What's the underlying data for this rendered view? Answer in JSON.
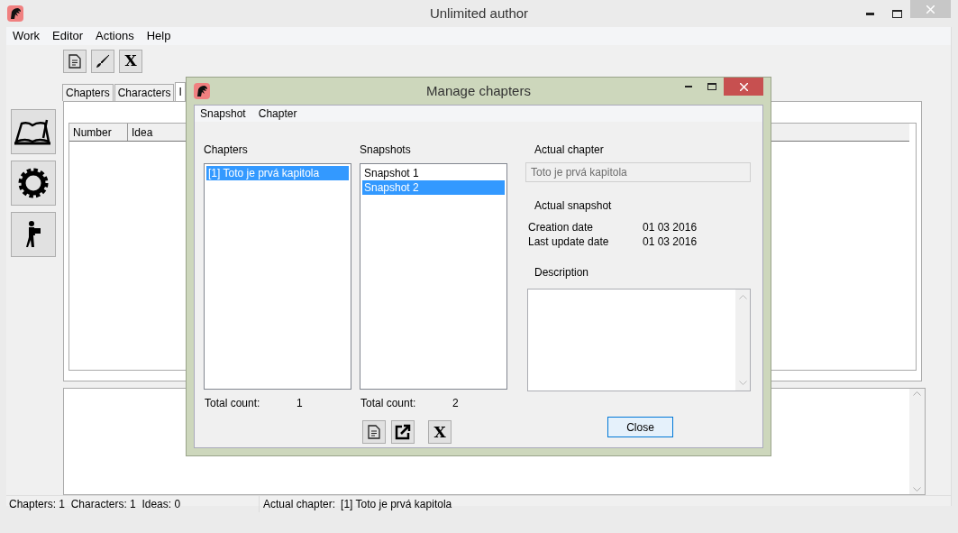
{
  "window": {
    "title": "Unlimited author"
  },
  "menu": [
    "Work",
    "Editor",
    "Actions",
    "Help"
  ],
  "tabs": [
    {
      "label": "Chapters",
      "selected": false
    },
    {
      "label": "Characters",
      "selected": false
    },
    {
      "label": "I",
      "selected": true
    }
  ],
  "table": {
    "columns": [
      "Number",
      "Idea"
    ]
  },
  "status_bar": {
    "counts": "Chapters: 1  Characters: 1  Ideas: 0",
    "actual_label": "Actual chapter:",
    "actual_value": "[1] Toto je prvá kapitola"
  },
  "dialog": {
    "title": "Manage chapters",
    "menu": [
      "Snapshot",
      "Chapter"
    ],
    "chapters": {
      "label": "Chapters",
      "items": [
        {
          "text": "[1] Toto je prvá kapitola",
          "selected": true
        }
      ],
      "count_label": "Total count:",
      "count": "1"
    },
    "snapshots": {
      "label": "Snapshots",
      "items": [
        {
          "text": "Snapshot 1",
          "selected": false
        },
        {
          "text": "Snapshot 2",
          "selected": true
        }
      ],
      "count_label": "Total count:",
      "count": "2"
    },
    "actual_chapter": {
      "label": "Actual chapter",
      "value": "Toto je prvá kapitola"
    },
    "actual_snapshot": {
      "label": "Actual snapshot",
      "rows": [
        {
          "label": "Creation date",
          "value": "01 03 2016"
        },
        {
          "label": "Last update date",
          "value": "01 03 2016"
        }
      ]
    },
    "description": {
      "label": "Description"
    },
    "x_glyph": "X",
    "close": "Close"
  },
  "toolbar_x_glyph": "X"
}
